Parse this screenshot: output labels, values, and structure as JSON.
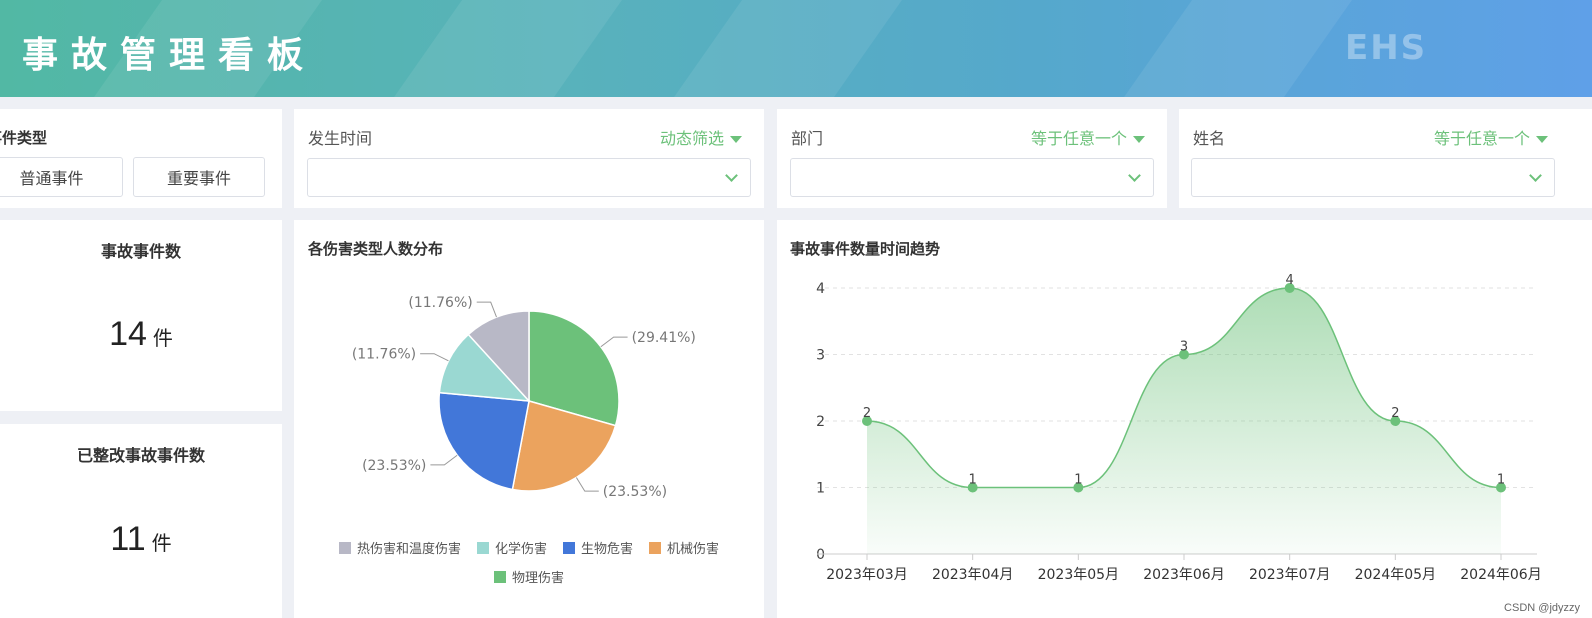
{
  "header": {
    "title": "事故管理看板",
    "logo": "EHS"
  },
  "filters": {
    "event_type": {
      "label": "事件类型",
      "buttons": [
        "普通事件",
        "重要事件"
      ]
    },
    "occur_time": {
      "label": "发生时间",
      "mode": "动态筛选",
      "value": ""
    },
    "department": {
      "label": "部门",
      "mode": "等于任意一个",
      "value": ""
    },
    "name": {
      "label": "姓名",
      "mode": "等于任意一个",
      "value": ""
    }
  },
  "kpis": [
    {
      "title": "事故事件数",
      "value": "14",
      "unit": "件"
    },
    {
      "title": "已整改事故事件数",
      "value": "11",
      "unit": "件"
    }
  ],
  "pie_title": "各伤害类型人数分布",
  "line_title": "事故事件数量时间趋势",
  "watermark": "CSDN @jdyzzy",
  "colors": {
    "accent": "#6cc17a",
    "banner_start": "#52b8a4",
    "banner_end": "#5fa0e8"
  },
  "chart_data": [
    {
      "type": "pie",
      "title": "各伤害类型人数分布",
      "slices": [
        {
          "name": "物理伤害",
          "value": 29.41,
          "label": "(29.41%)",
          "color": "#6cc17a"
        },
        {
          "name": "机械伤害",
          "value": 23.53,
          "label": "(23.53%)",
          "color": "#eba35e"
        },
        {
          "name": "生物危害",
          "value": 23.53,
          "label": "(23.53%)",
          "color": "#4277d9"
        },
        {
          "name": "化学伤害",
          "value": 11.76,
          "label": "(11.76%)",
          "color": "#9ad8d2"
        },
        {
          "name": "热伤害和温度伤害",
          "value": 11.76,
          "label": "(11.76%)",
          "color": "#b8b8c6"
        }
      ],
      "legend": [
        "热伤害和温度伤害",
        "化学伤害",
        "生物危害",
        "机械伤害",
        "物理伤害"
      ],
      "legend_position": "bottom"
    },
    {
      "type": "area",
      "title": "事故事件数量时间趋势",
      "categories": [
        "2023年03月",
        "2023年04月",
        "2023年05月",
        "2023年06月",
        "2023年07月",
        "2024年05月",
        "2024年06月"
      ],
      "values": [
        2,
        1,
        1,
        3,
        4,
        2,
        1
      ],
      "ylim": [
        0,
        4
      ],
      "yticks": [
        0,
        1,
        2,
        3,
        4
      ],
      "grid": true,
      "color": "#6cc17a"
    }
  ]
}
